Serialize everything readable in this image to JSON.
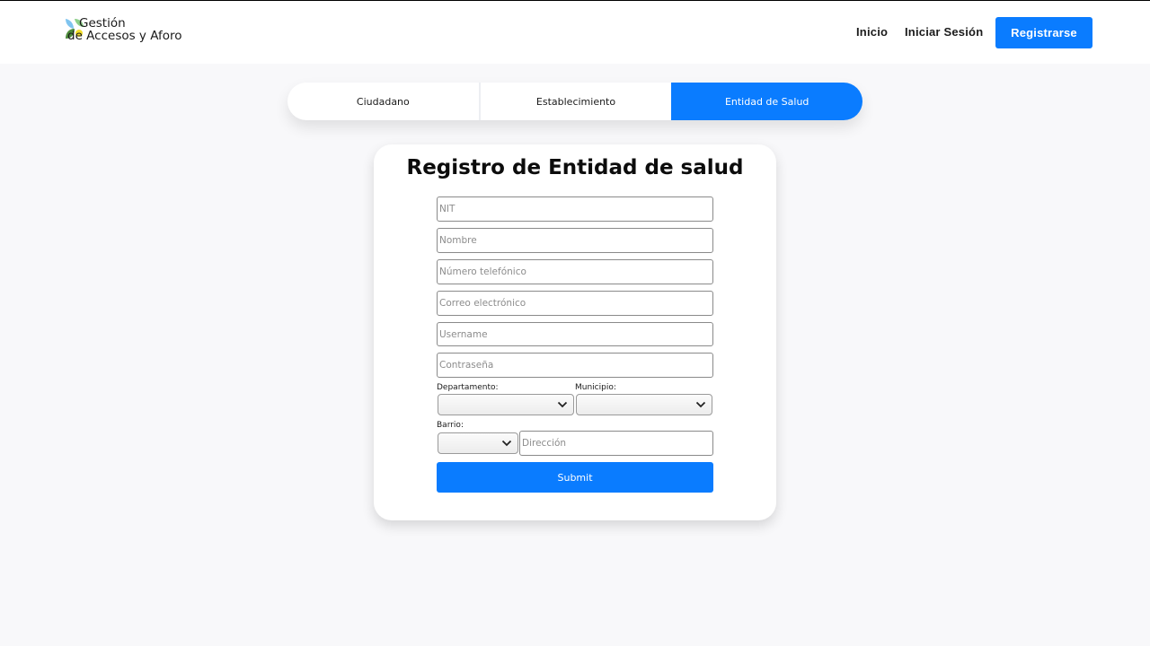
{
  "header": {
    "logo": {
      "line1": "Gestión",
      "line2": "de Accesos y Aforo"
    },
    "nav": {
      "home": "Inicio",
      "login": "Iniciar Sesión",
      "register": "Registrarse"
    }
  },
  "tabs": [
    {
      "label": "Ciudadano",
      "active": false
    },
    {
      "label": "Establecimiento",
      "active": false
    },
    {
      "label": "Entidad de Salud",
      "active": true
    }
  ],
  "form": {
    "title": "Registro de Entidad de salud",
    "fields": {
      "nit": {
        "placeholder": "NIT",
        "value": ""
      },
      "nombre": {
        "placeholder": "Nombre",
        "value": ""
      },
      "telefono": {
        "placeholder": "Número telefónico",
        "value": ""
      },
      "correo": {
        "placeholder": "Correo electrónico",
        "value": ""
      },
      "username": {
        "placeholder": "Username",
        "value": ""
      },
      "password": {
        "placeholder": "Contraseña",
        "value": ""
      },
      "direccion": {
        "placeholder": "Dirección",
        "value": ""
      }
    },
    "labels": {
      "departamento": "Departamento:",
      "municipio": "Municipio:",
      "barrio": "Barrio:"
    },
    "selects": {
      "departamento": "",
      "municipio": "",
      "barrio": ""
    },
    "submit": "Submit"
  },
  "colors": {
    "accent": "#0a7cff",
    "background": "#f8f8fa",
    "card": "#ffffff"
  },
  "icons": [
    "logo-leaves-icon",
    "chevron-down-icon"
  ]
}
